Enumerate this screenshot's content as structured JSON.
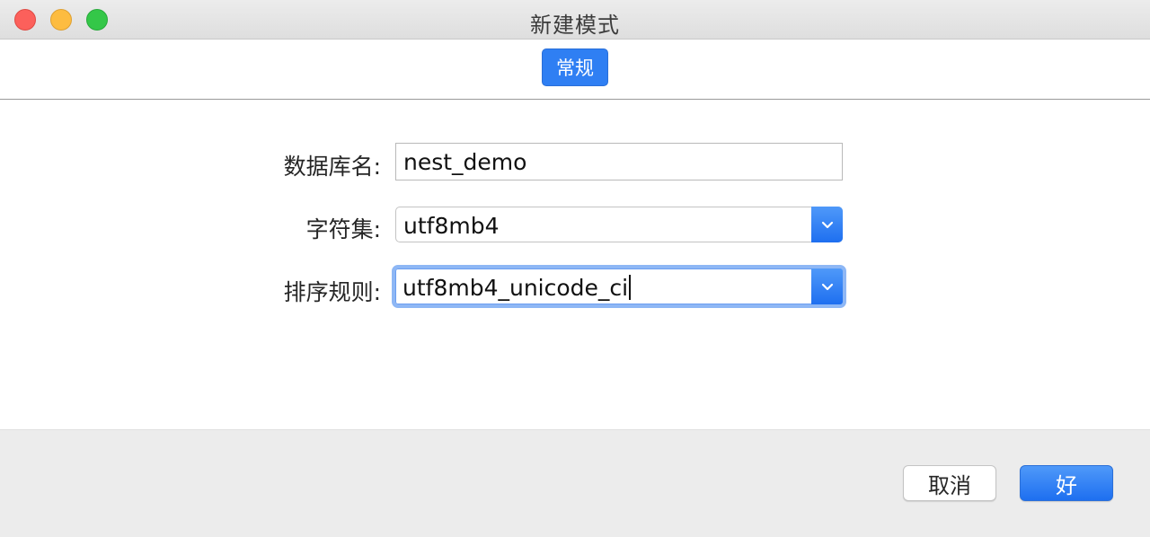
{
  "window": {
    "title": "新建模式"
  },
  "tabs": [
    {
      "label": "常规",
      "selected": true
    }
  ],
  "form": {
    "db_name_label": "数据库名:",
    "db_name_value": "nest_demo",
    "charset_label": "字符集:",
    "charset_value": "utf8mb4",
    "collation_label": "排序规则:",
    "collation_value": "utf8mb4_unicode_ci"
  },
  "footer": {
    "cancel_label": "取消",
    "ok_label": "好"
  },
  "colors": {
    "accent": "#2f7ff3",
    "close": "#fc605b",
    "minimize": "#fdbc40",
    "maximize": "#34c748"
  },
  "icons": [
    "close-window-icon",
    "minimize-window-icon",
    "maximize-window-icon",
    "chevron-down-icon"
  ]
}
